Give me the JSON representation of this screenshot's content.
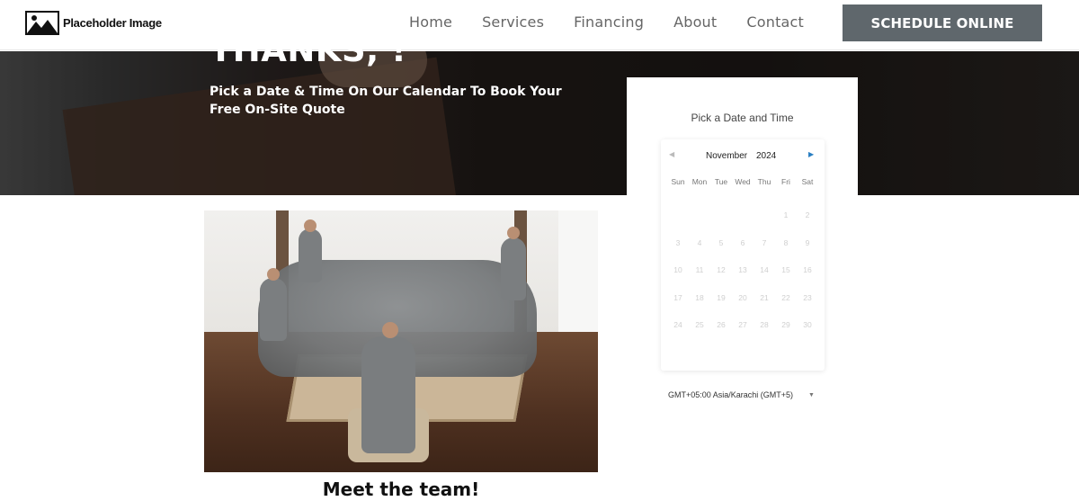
{
  "header": {
    "logo_text": "Placeholder Image",
    "nav": [
      "Home",
      "Services",
      "Financing",
      "About",
      "Contact"
    ],
    "cta_label": "SCHEDULE ONLINE"
  },
  "hero": {
    "title": "THANKS, !",
    "subtitle": "Pick a Date & Time On Our Calendar To Book Your Free On-Site Quote"
  },
  "calendar": {
    "heading": "Pick a Date and Time",
    "month": "November",
    "year": "2024",
    "weekdays": [
      "Sun",
      "Mon",
      "Tue",
      "Wed",
      "Thu",
      "Fri",
      "Sat"
    ],
    "leading_blanks": 5,
    "days": [
      "1",
      "2",
      "3",
      "4",
      "5",
      "6",
      "7",
      "8",
      "9",
      "10",
      "11",
      "12",
      "13",
      "14",
      "15",
      "16",
      "17",
      "18",
      "19",
      "20",
      "21",
      "22",
      "23",
      "24",
      "25",
      "26",
      "27",
      "28",
      "29",
      "30"
    ],
    "timezone": "GMT+05:00 Asia/Karachi (GMT+5)"
  },
  "team": {
    "caption": "Meet the team!"
  },
  "colors": {
    "cta_bg": "#5f676c",
    "nav_text": "#666666",
    "next_arrow": "#2a7fc2"
  },
  "icons": {
    "logo": "image-placeholder-icon",
    "prev": "chevron-left-icon",
    "next": "chevron-right-icon",
    "tz": "caret-down-icon"
  }
}
